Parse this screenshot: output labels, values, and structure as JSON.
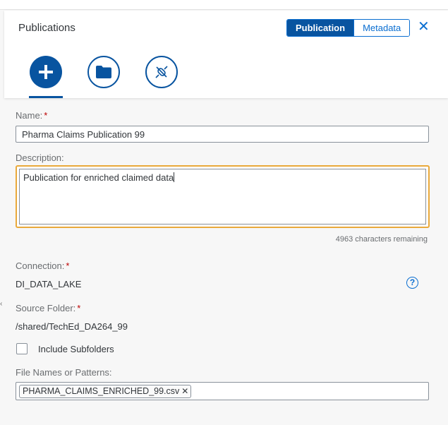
{
  "header": {
    "title": "Publications",
    "segments": [
      {
        "label": "Publication",
        "active": true
      },
      {
        "label": "Metadata",
        "active": false
      }
    ],
    "close_icon": "close-icon"
  },
  "toolbar": {
    "buttons": [
      {
        "icon": "add-icon",
        "style": "filled"
      },
      {
        "icon": "folder-icon",
        "style": "outline"
      },
      {
        "icon": "disconnected-icon",
        "style": "outline"
      }
    ]
  },
  "form": {
    "name_label": "Name:",
    "name_value": "Pharma Claims Publication 99",
    "description_label": "Description:",
    "description_value": "Publication for enriched claimed data",
    "remaining": "4963 characters remaining",
    "connection_label": "Connection:",
    "connection_value": "DI_DATA_LAKE",
    "source_folder_label": "Source Folder:",
    "source_folder_value": "/shared/TechEd_DA264_99",
    "include_subfolders_label": "Include Subfolders",
    "include_subfolders_checked": false,
    "file_patterns_label": "File Names or Patterns:",
    "file_tokens": [
      "PHARMA_CLAIMS_ENRICHED_99.csv"
    ],
    "required_mark": "*"
  },
  "colors": {
    "accent": "#0854a0",
    "focus": "#e9a93b",
    "required": "#bb0000"
  }
}
